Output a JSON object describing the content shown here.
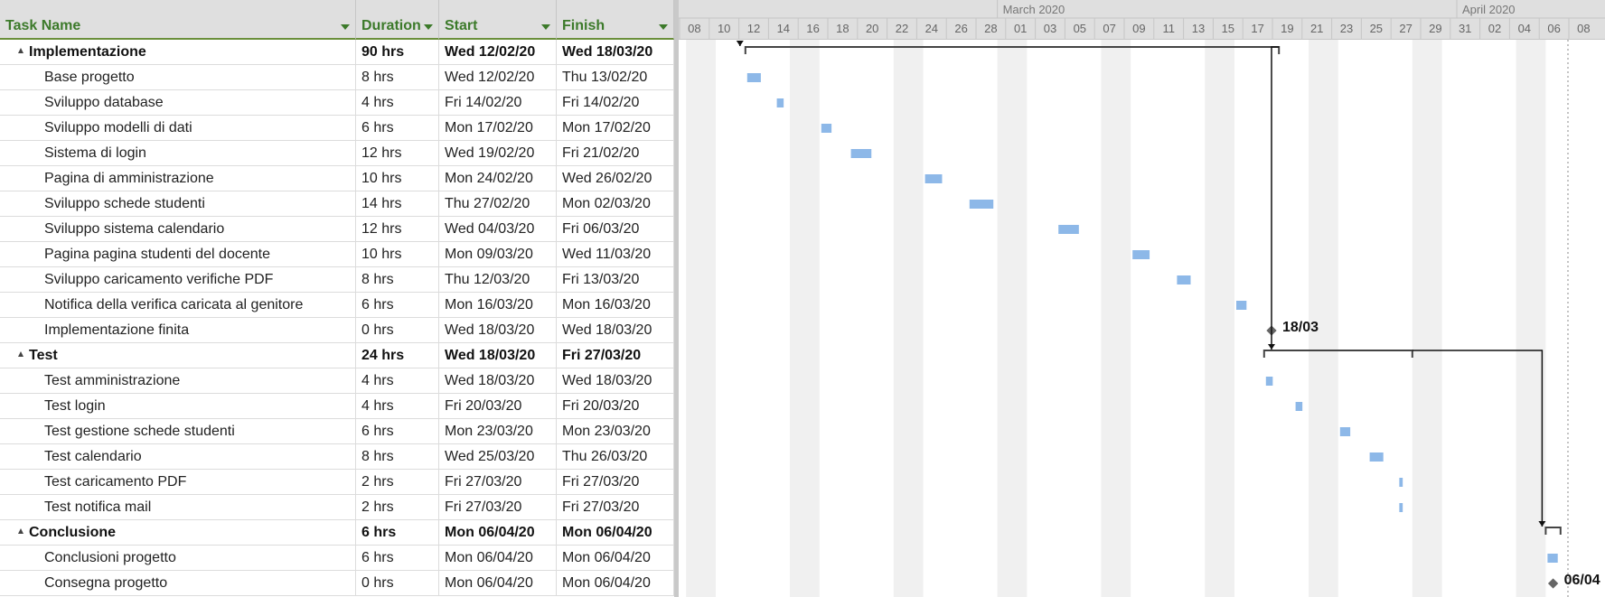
{
  "columns": {
    "task_name": "Task Name",
    "duration": "Duration",
    "start": "Start",
    "finish": "Finish"
  },
  "timescale": {
    "months": [
      "March 2020",
      "April 2020"
    ],
    "days": [
      "08",
      "10",
      "12",
      "14",
      "16",
      "18",
      "20",
      "22",
      "24",
      "26",
      "28",
      "01",
      "03",
      "05",
      "07",
      "09",
      "11",
      "13",
      "15",
      "17",
      "19",
      "21",
      "23",
      "25",
      "27",
      "29",
      "31",
      "02",
      "04",
      "06",
      "08"
    ]
  },
  "tasks": [
    {
      "name": "Implementazione",
      "duration": "90 hrs",
      "start": "Wed 12/02/20",
      "finish": "Wed 18/03/20",
      "summary": true
    },
    {
      "name": "Base progetto",
      "duration": "8 hrs",
      "start": "Wed 12/02/20",
      "finish": "Thu 13/02/20"
    },
    {
      "name": "Sviluppo database",
      "duration": "4 hrs",
      "start": "Fri 14/02/20",
      "finish": "Fri 14/02/20"
    },
    {
      "name": "Sviluppo modelli di dati",
      "duration": "6 hrs",
      "start": "Mon 17/02/20",
      "finish": "Mon 17/02/20"
    },
    {
      "name": "Sistema di login",
      "duration": "12 hrs",
      "start": "Wed 19/02/20",
      "finish": "Fri 21/02/20"
    },
    {
      "name": "Pagina di amministrazione",
      "duration": "10 hrs",
      "start": "Mon 24/02/20",
      "finish": "Wed 26/02/20"
    },
    {
      "name": "Sviluppo schede studenti",
      "duration": "14 hrs",
      "start": "Thu 27/02/20",
      "finish": "Mon 02/03/20"
    },
    {
      "name": "Sviluppo sistema calendario",
      "duration": "12 hrs",
      "start": "Wed 04/03/20",
      "finish": "Fri 06/03/20"
    },
    {
      "name": "Pagina pagina studenti del docente",
      "duration": "10 hrs",
      "start": "Mon 09/03/20",
      "finish": "Wed 11/03/20"
    },
    {
      "name": "Sviluppo caricamento verifiche PDF",
      "duration": "8 hrs",
      "start": "Thu 12/03/20",
      "finish": "Fri 13/03/20"
    },
    {
      "name": "Notifica della verifica caricata al genitore",
      "duration": "6 hrs",
      "start": "Mon 16/03/20",
      "finish": "Mon 16/03/20"
    },
    {
      "name": "Implementazione finita",
      "duration": "0 hrs",
      "start": "Wed 18/03/20",
      "finish": "Wed 18/03/20",
      "milestone_label": "18/03"
    },
    {
      "name": "Test",
      "duration": "24 hrs",
      "start": "Wed 18/03/20",
      "finish": "Fri 27/03/20",
      "summary": true
    },
    {
      "name": "Test amministrazione",
      "duration": "4 hrs",
      "start": "Wed 18/03/20",
      "finish": "Wed 18/03/20"
    },
    {
      "name": "Test login",
      "duration": "4 hrs",
      "start": "Fri 20/03/20",
      "finish": "Fri 20/03/20"
    },
    {
      "name": "Test gestione schede studenti",
      "duration": "6 hrs",
      "start": "Mon 23/03/20",
      "finish": "Mon 23/03/20"
    },
    {
      "name": "Test calendario",
      "duration": "8 hrs",
      "start": "Wed 25/03/20",
      "finish": "Thu 26/03/20"
    },
    {
      "name": "Test caricamento PDF",
      "duration": "2 hrs",
      "start": "Fri 27/03/20",
      "finish": "Fri 27/03/20"
    },
    {
      "name": "Test notifica mail",
      "duration": "2 hrs",
      "start": "Fri 27/03/20",
      "finish": "Fri 27/03/20"
    },
    {
      "name": "Conclusione",
      "duration": "6 hrs",
      "start": "Mon 06/04/20",
      "finish": "Mon 06/04/20",
      "summary": true
    },
    {
      "name": "Conclusioni progetto",
      "duration": "6 hrs",
      "start": "Mon 06/04/20",
      "finish": "Mon 06/04/20"
    },
    {
      "name": "Consegna progetto",
      "duration": "0 hrs",
      "start": "Mon 06/04/20",
      "finish": "Mon 06/04/20",
      "milestone_label": "06/04"
    }
  ],
  "colors": {
    "bar": "#8db8e8",
    "summary_line": "#444444",
    "milestone": "#666666",
    "header_bg": "#dfdfdf",
    "header_text": "#3c7a2a",
    "weekend_shade": "#f0f0f0"
  }
}
